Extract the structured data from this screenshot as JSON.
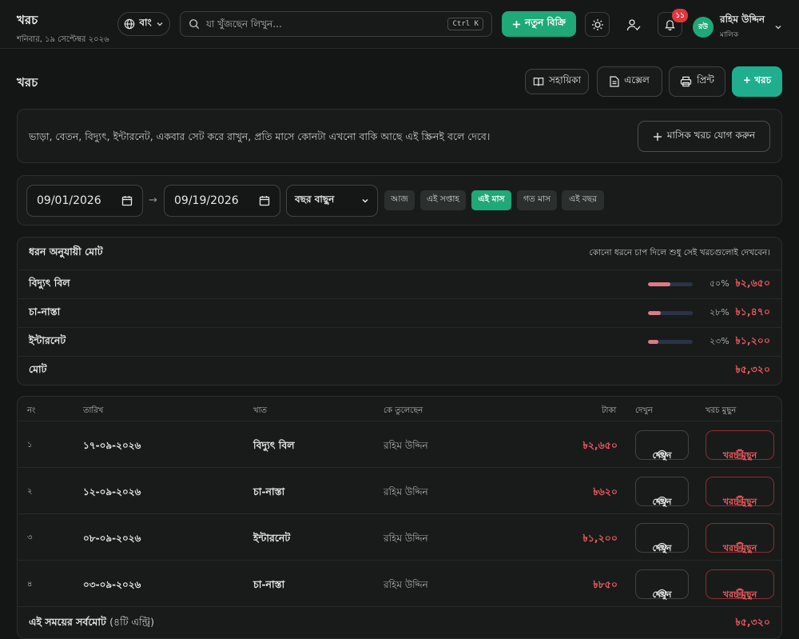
{
  "header": {
    "title": "খরচ",
    "date": "শনিবার, ১৯ সেপ্টেম্বর ২০২৬",
    "language": "বাং",
    "search_placeholder": "যা খুঁজছেন লিখুন...",
    "shortcut": "Ctrl K",
    "new_sale": "নতুন বিক্রি",
    "notification_count": "১১",
    "user_initials": "রউ",
    "user_name": "রহিম উদ্দিন",
    "user_role": "মালিক"
  },
  "page": {
    "title": "খরচ",
    "help": "সহায়িকা",
    "excel": "এক্সেল",
    "print": "প্রিন্ট",
    "add": "+ খরচ"
  },
  "banner": {
    "text": "ভাড়া, বেতন, বিদ্যুৎ, ইন্টারনেট, একবার সেট করে রাখুন, প্রতি মাসে কোনটা এখনো বাকি আছে এই স্ক্রিনই বলে দেবে।",
    "button": "মাসিক খরচ যোগ করুন"
  },
  "filters": {
    "from": "09/01/2026",
    "to": "09/19/2026",
    "year_select": "বছর বাছুন",
    "chips": [
      "আজ",
      "এই সপ্তাহ",
      "এই মাস",
      "গত মাস",
      "এই বছর"
    ],
    "active_chip": "এই মাস"
  },
  "summary": {
    "title": "ধরন অনুযায়ী মোট",
    "hint": "কোনো ধরনে চাপ দিলে শুধু সেই খরচগুলোই দেখবেন।",
    "rows": [
      {
        "label": "বিদ্যুৎ বিল",
        "percent": 50,
        "percent_label": "৫০%",
        "amount": "৳২,৬৫০"
      },
      {
        "label": "চা-নাস্তা",
        "percent": 28,
        "percent_label": "২৮%",
        "amount": "৳১,৪৭০"
      },
      {
        "label": "ইন্টারনেট",
        "percent": 23,
        "percent_label": "২৩%",
        "amount": "৳১,২০০"
      }
    ],
    "total_label": "মোট",
    "total_amount": "৳৫,৩২০",
    "bar_color": "#e07a85"
  },
  "table": {
    "columns": [
      "নং",
      "তারিখ",
      "খাত",
      "কে তুলেছেন",
      "টাকা",
      "দেখুন",
      "খরচ মুছুন"
    ],
    "view_label": "দেখুন",
    "delete_label": "খরচ মুছুন",
    "rows": [
      {
        "no": "১",
        "date": "১৭-০৯-২০২৬",
        "category": "বিদ্যুৎ বিল",
        "by": "রহিম উদ্দিন",
        "amount": "৳২,৬৫০"
      },
      {
        "no": "২",
        "date": "১২-০৯-২০২৬",
        "category": "চা-নাস্তা",
        "by": "রহিম উদ্দিন",
        "amount": "৳৬২০"
      },
      {
        "no": "৩",
        "date": "০৮-০৯-২০২৬",
        "category": "ইন্টারনেট",
        "by": "রহিম উদ্দিন",
        "amount": "৳১,২০০"
      },
      {
        "no": "৪",
        "date": "০৩-০৯-২০২৬",
        "category": "চা-নাস্তা",
        "by": "রহিম উদ্দিন",
        "amount": "৳৮৫০"
      }
    ],
    "total_label": "এই সময়ের সর্বমোট",
    "total_count": "(৪টি এন্ট্রি)",
    "total_amount": "৳৫,৩২০"
  },
  "colors": {
    "accent": "#1fa878",
    "danger": "#ef5a60",
    "background": "#131615"
  }
}
